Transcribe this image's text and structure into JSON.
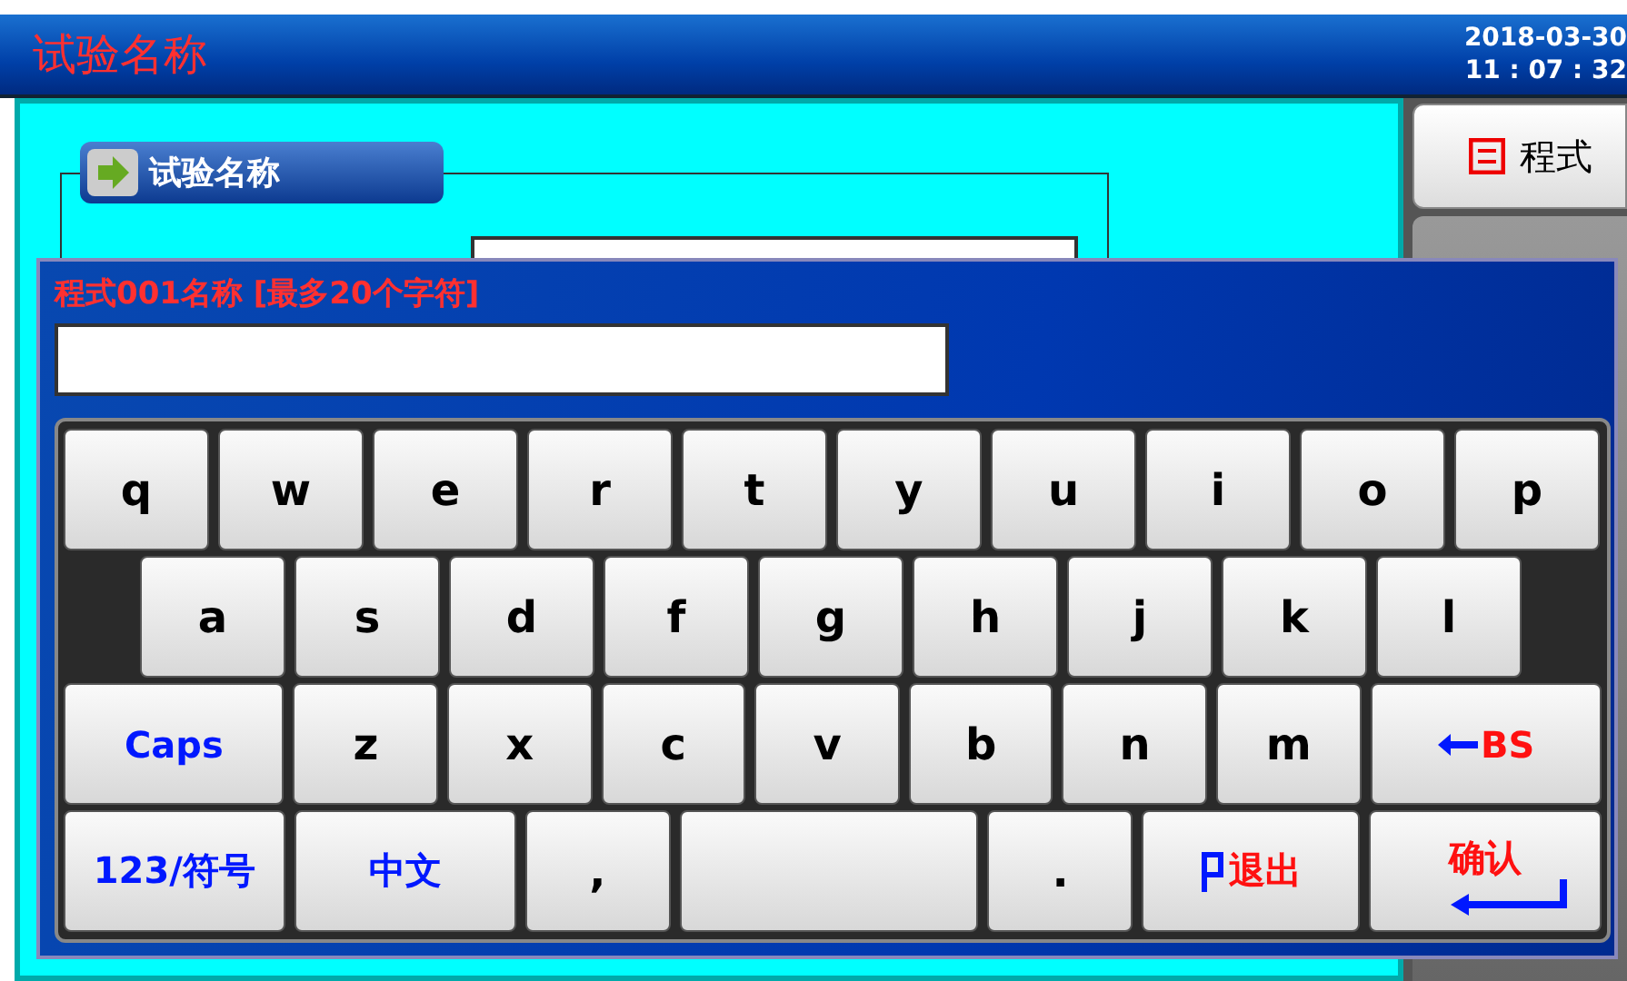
{
  "title_bar": {
    "title": "试验名称",
    "date": "2018-03-30",
    "time": "11 : 07 : 32"
  },
  "side_buttons": [
    {
      "label": "程式"
    }
  ],
  "group": {
    "label": "试验名称"
  },
  "dialog": {
    "title": "程式001名称 [最多20个字符]",
    "key_rows": [
      {
        "keys": [
          {
            "kind": "char",
            "label": "q"
          },
          {
            "kind": "char",
            "label": "w"
          },
          {
            "kind": "char",
            "label": "e"
          },
          {
            "kind": "char",
            "label": "r"
          },
          {
            "kind": "char",
            "label": "t"
          },
          {
            "kind": "char",
            "label": "y"
          },
          {
            "kind": "char",
            "label": "u"
          },
          {
            "kind": "char",
            "label": "i"
          },
          {
            "kind": "char",
            "label": "o"
          },
          {
            "kind": "char",
            "label": "p"
          }
        ]
      },
      {
        "keys": [
          {
            "kind": "char",
            "label": "a"
          },
          {
            "kind": "char",
            "label": "s"
          },
          {
            "kind": "char",
            "label": "d"
          },
          {
            "kind": "char",
            "label": "f"
          },
          {
            "kind": "char",
            "label": "g"
          },
          {
            "kind": "char",
            "label": "h"
          },
          {
            "kind": "char",
            "label": "j"
          },
          {
            "kind": "char",
            "label": "k"
          },
          {
            "kind": "char",
            "label": "l"
          }
        ]
      },
      {
        "keys": [
          {
            "kind": "mode",
            "label": "Caps"
          },
          {
            "kind": "char",
            "label": "z"
          },
          {
            "kind": "char",
            "label": "x"
          },
          {
            "kind": "char",
            "label": "c"
          },
          {
            "kind": "char",
            "label": "v"
          },
          {
            "kind": "char",
            "label": "b"
          },
          {
            "kind": "char",
            "label": "n"
          },
          {
            "kind": "char",
            "label": "m"
          },
          {
            "kind": "backspace",
            "label": "BS"
          }
        ]
      },
      {
        "keys": [
          {
            "kind": "mode",
            "label": "123/符号"
          },
          {
            "kind": "mode",
            "label": "中文"
          },
          {
            "kind": "char",
            "label": ","
          },
          {
            "kind": "space"
          },
          {
            "kind": "char",
            "label": "."
          },
          {
            "kind": "exit",
            "label": "退出"
          },
          {
            "kind": "enter",
            "label": "确认"
          }
        ]
      }
    ]
  }
}
